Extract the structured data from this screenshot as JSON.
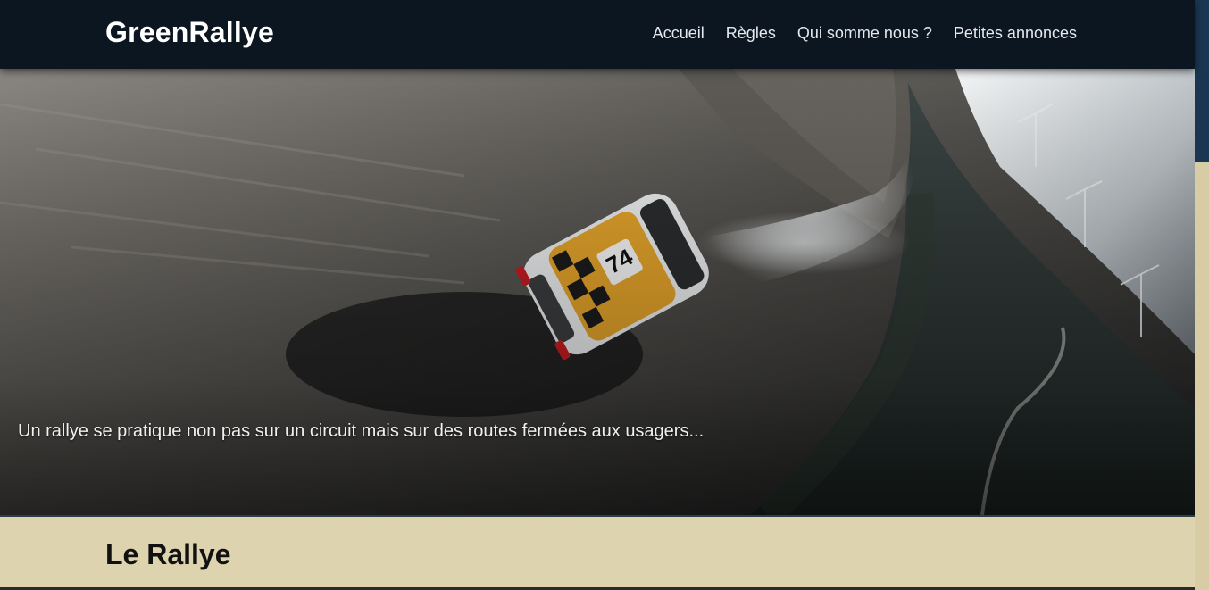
{
  "navbar": {
    "brand": "GreenRallye",
    "links": [
      "Accueil",
      "Règles",
      "Qui somme nous ?",
      "Petites annonces"
    ]
  },
  "hero": {
    "caption": "Un rallye se pratique non pas sur un circuit mais sur des routes fermées aux usagers...",
    "image": "rally-car-drifting-on-gravel-mountain-road",
    "car_number": "74"
  },
  "main": {
    "section_title": "Le Rallye"
  },
  "colors": {
    "navbar_bg": "#0b1620",
    "content_bg": "#ddd3ae",
    "scroll_thumb": "#1a3652"
  }
}
